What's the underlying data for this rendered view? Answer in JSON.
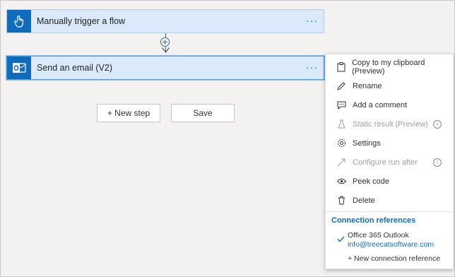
{
  "flow": {
    "trigger": {
      "title": "Manually trigger a flow",
      "more": "···",
      "icon": "touch-hand-icon"
    },
    "action": {
      "title": "Send an email (V2)",
      "more": "···",
      "icon": "outlook-icon"
    }
  },
  "buttons": {
    "new_step": "+ New step",
    "save": "Save"
  },
  "context_menu": {
    "items": [
      {
        "label": "Copy to my clipboard (Preview)",
        "icon": "clipboard-icon",
        "disabled": false
      },
      {
        "label": "Rename",
        "icon": "pencil-icon",
        "disabled": false
      },
      {
        "label": "Add a comment",
        "icon": "comment-icon",
        "disabled": false
      },
      {
        "label": "Static result (Preview)",
        "icon": "flask-icon",
        "disabled": true
      },
      {
        "label": "Settings",
        "icon": "gear-icon",
        "disabled": false
      },
      {
        "label": "Configure run after",
        "icon": "arrow-icon",
        "disabled": true
      },
      {
        "label": "Peek code",
        "icon": "eye-icon",
        "disabled": false
      },
      {
        "label": "Delete",
        "icon": "trash-icon",
        "disabled": false
      }
    ],
    "info_glyph": "i",
    "connection_section": {
      "title": "Connection references",
      "connection_name": "Office 365 Outlook",
      "connection_account": "info@treecatsoftware.com",
      "new_connection": "+ New connection reference"
    }
  },
  "colors": {
    "accent": "#0f6cbd",
    "card_bg": "#dbeafb",
    "canvas_bg": "#f3f2f1"
  }
}
